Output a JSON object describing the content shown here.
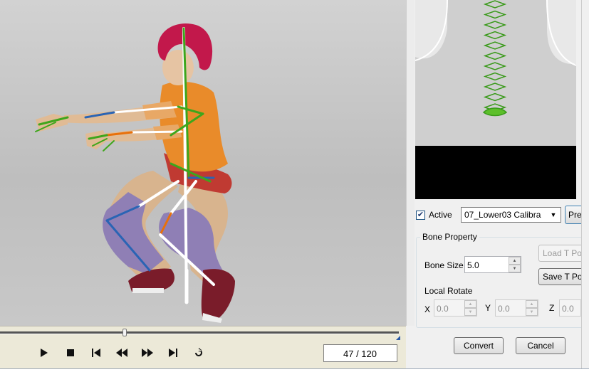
{
  "playback": {
    "frame_text": "47 / 120",
    "current_frame": 47,
    "total_frames": 120,
    "buttons": [
      "play-icon",
      "stop-icon",
      "skip-to-start-icon",
      "rewind-icon",
      "fast-forward-icon",
      "skip-to-end-icon",
      "loop-icon"
    ]
  },
  "panel": {
    "active_label": "Active",
    "active_checked": true,
    "bone_select_value": "07_Lower03 Calibra",
    "preview_button_label": "Prev",
    "bone_property": {
      "title": "Bone Property",
      "bone_size_label": "Bone Size",
      "bone_size_value": "5.0",
      "load_t_pose_label": "Load T Po",
      "save_t_pose_label": "Save T Po",
      "local_rotate_label": "Local Rotate",
      "x_label": "X",
      "x_value": "0.0",
      "y_label": "Y",
      "y_value": "0.0",
      "z_label": "Z",
      "z_value": "0.0"
    },
    "convert_label": "Convert",
    "cancel_label": "Cancel"
  },
  "colors": {
    "bone_green": "#3ea61c",
    "bone_orange": "#e8700a",
    "bone_blue": "#2a64b4",
    "bone_white": "#ffffff",
    "hair": "#c2184b",
    "accent_blue": "#2a5aa8"
  }
}
